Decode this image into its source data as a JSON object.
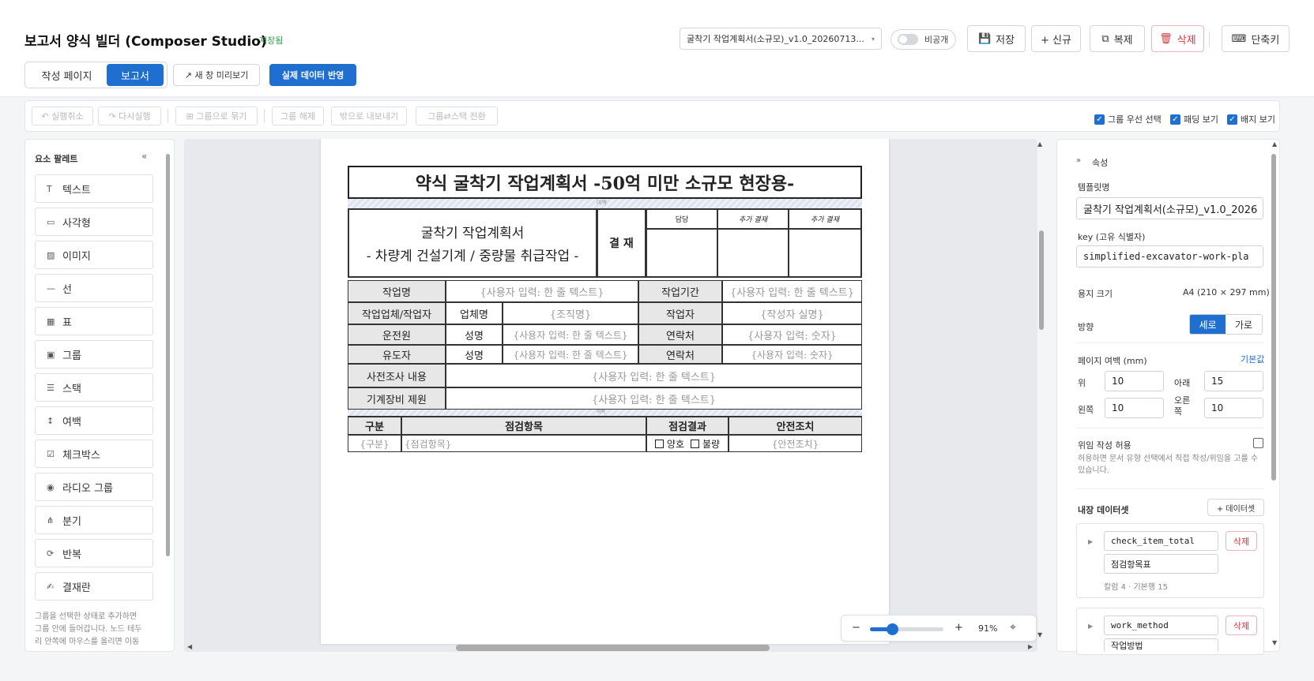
{
  "app": {
    "title": "보고서 양식 빌더 (Composer Studio)",
    "saved_status": "저장됨"
  },
  "header": {
    "template_select": "굴착기 작업계획서(소규모)_v1.0_20260713...",
    "visibility_label": "비공개",
    "save": "저장",
    "new": "+ 신규",
    "copy": "복제",
    "delete": "삭제",
    "shortcuts": "단축키"
  },
  "mode_tabs": [
    {
      "label": "작성 페이지",
      "active": false
    },
    {
      "label": "보고서",
      "active": true
    }
  ],
  "preview_button": "↗ 새 창 미리보기",
  "apply_data_button": "실제 데이터 반영",
  "toolbar": {
    "undo": "↶ 실행취소",
    "redo": "↷ 다시실행",
    "group": "⊞ 그룹으로 묶기",
    "ungroup": "그룹 해제",
    "export_out": "밖으로 내보내기",
    "toggle": "그룹⇄스택 전환",
    "options": [
      "그룹 우선 선택",
      "패딩 보기",
      "배지 보기"
    ]
  },
  "palette": {
    "title": "요소 팔레트",
    "collapse": "«",
    "items": [
      {
        "icon": "T",
        "label": "텍스트"
      },
      {
        "icon": "▭",
        "label": "사각형"
      },
      {
        "icon": "▨",
        "label": "이미지"
      },
      {
        "icon": "—",
        "label": "선"
      },
      {
        "icon": "▦",
        "label": "표"
      },
      {
        "icon": "▣",
        "label": "그룹"
      },
      {
        "icon": "☰",
        "label": "스택"
      },
      {
        "icon": "↕",
        "label": "여백"
      },
      {
        "icon": "☑",
        "label": "체크박스"
      },
      {
        "icon": "◉",
        "label": "라디오 그룹"
      },
      {
        "icon": "⋔",
        "label": "분기"
      },
      {
        "icon": "⟳",
        "label": "반복"
      },
      {
        "icon": "✍",
        "label": "결재란"
      }
    ],
    "hint": "그룹을 선택한 상태로 추가하면 그룹 안에 들어갑니다. 노드 테두리 안쪽에 마우스를 올리면 이동"
  },
  "doc": {
    "title": "약식 굴착기 작업계획서 -50억 미만 소규모 현장용-",
    "spacer": "여백",
    "subtitle1": "굴착기 작업계획서",
    "subtitle2": "- 차량계 건설기계 / 중량물 취급작업 -",
    "approval_label": "결 재",
    "approval_cols": [
      "담당",
      "추가 결재",
      "추가 결재"
    ],
    "row_work_name": "작업명",
    "ph_one_line": "{사용자 입력: 한 줄 텍스트}",
    "row_period": "작업기간",
    "row_company": "작업업체/작업자",
    "company_name": "업체명",
    "ph_org": "{조직명}",
    "worker": "작업자",
    "ph_author": "{작성자 실명}",
    "driver": "운전원",
    "name": "성명",
    "contact": "연락처",
    "ph_number": "{사용자 입력: 숫자}",
    "guide": "유도자",
    "survey": "사전조사 내용",
    "equipment": "기계장비 제원",
    "check_headers": [
      "구분",
      "점검항목",
      "점검결과",
      "안전조치"
    ],
    "ph_category": "{구분}",
    "ph_item": "{점검항목}",
    "result_good": "양호",
    "result_bad": "불량",
    "ph_safety": "{안전조치}"
  },
  "zoom": {
    "minus": "−",
    "plus": "+",
    "value": "91%",
    "level": 0.3
  },
  "props": {
    "title": "속성",
    "template_name_label": "템플릿명",
    "template_name": "굴착기 작업계획서(소규모)_v1.0_2026",
    "key_label": "key (고유 식별자)",
    "key": "simplified-excavator-work-pla",
    "paper_label": "용지 크기",
    "paper": "A4 (210 × 297 mm)",
    "orientation_label": "방향",
    "portrait": "세로",
    "landscape": "가로",
    "margin_label": "페이지 여백 (mm)",
    "default_link": "기본값",
    "top_label": "위",
    "top": "10",
    "bottom_label": "아래",
    "bottom": "15",
    "left_label": "왼쪽",
    "left": "10",
    "right_label": "오른쪽",
    "right": "10",
    "delegate_label": "위임 작성 허용",
    "delegate_hint": "허용하면 문서 유형 선택에서 직접 작성/위임을 고를 수 있습니다.",
    "datasets_label": "내장 데이터셋",
    "add_dataset": "+ 데이터셋",
    "datasets": [
      {
        "key": "check_item_total",
        "name": "점검항목표",
        "meta": "칼럼 4 · 기본행 15",
        "delete": "삭제"
      },
      {
        "key": "work_method",
        "name": "작업방법",
        "delete": "삭제"
      }
    ]
  },
  "colors": {
    "accent": "#1f6fd1",
    "danger": "#d9363e",
    "saved": "#2e9a4b"
  }
}
